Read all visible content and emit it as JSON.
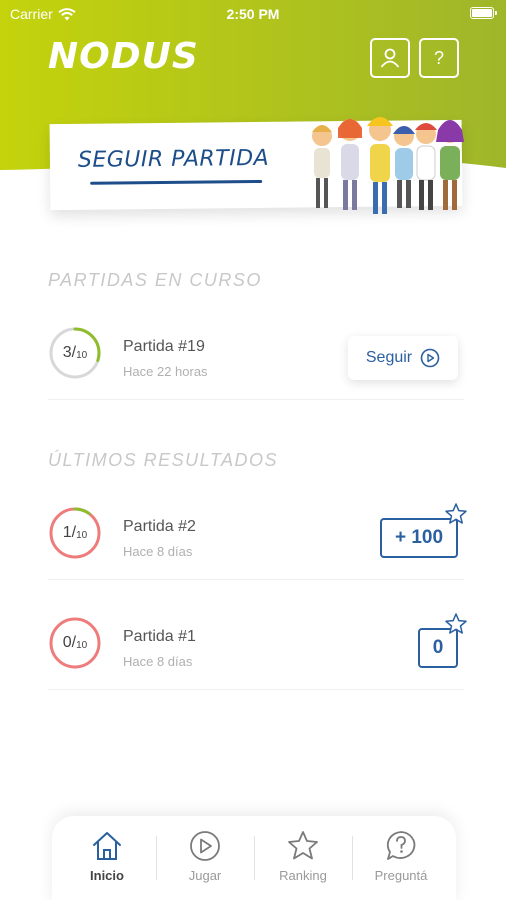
{
  "status_bar": {
    "carrier": "Carrier",
    "time": "2:50 PM"
  },
  "header": {
    "logo": "NODUS",
    "profile_icon": "user-icon",
    "help_label": "?"
  },
  "continue_banner": {
    "label": "SEGUIR PARTIDA"
  },
  "in_progress": {
    "title": "PARTIDAS EN CURSO",
    "items": [
      {
        "score": "3",
        "total": "10",
        "progress": 0.3,
        "name": "Partida #19",
        "time": "Hace 22 horas",
        "action_label": "Seguir"
      }
    ]
  },
  "results": {
    "title": "ÚLTIMOS RESULTADOS",
    "items": [
      {
        "score": "1",
        "total": "10",
        "progress": 0.1,
        "name": "Partida #2",
        "time": "Hace 8 días",
        "points": "+ 100"
      },
      {
        "score": "0",
        "total": "10",
        "progress": 0.0,
        "name": "Partida #1",
        "time": "Hace 8 días",
        "points": "0"
      }
    ]
  },
  "tabbar": {
    "tabs": [
      {
        "label": "Inicio",
        "icon": "home-icon",
        "active": true
      },
      {
        "label": "Jugar",
        "icon": "play-icon",
        "active": false
      },
      {
        "label": "Ranking",
        "icon": "star-icon",
        "active": false
      },
      {
        "label": "Preguntá",
        "icon": "question-bubble-icon",
        "active": false
      }
    ]
  },
  "colors": {
    "accent_green": "#a9c32a",
    "brand_blue": "#2a5fa0",
    "ring_green": "#8fbc2b",
    "ring_red": "#ef7c7c",
    "ring_gray": "#d8d8d8"
  }
}
